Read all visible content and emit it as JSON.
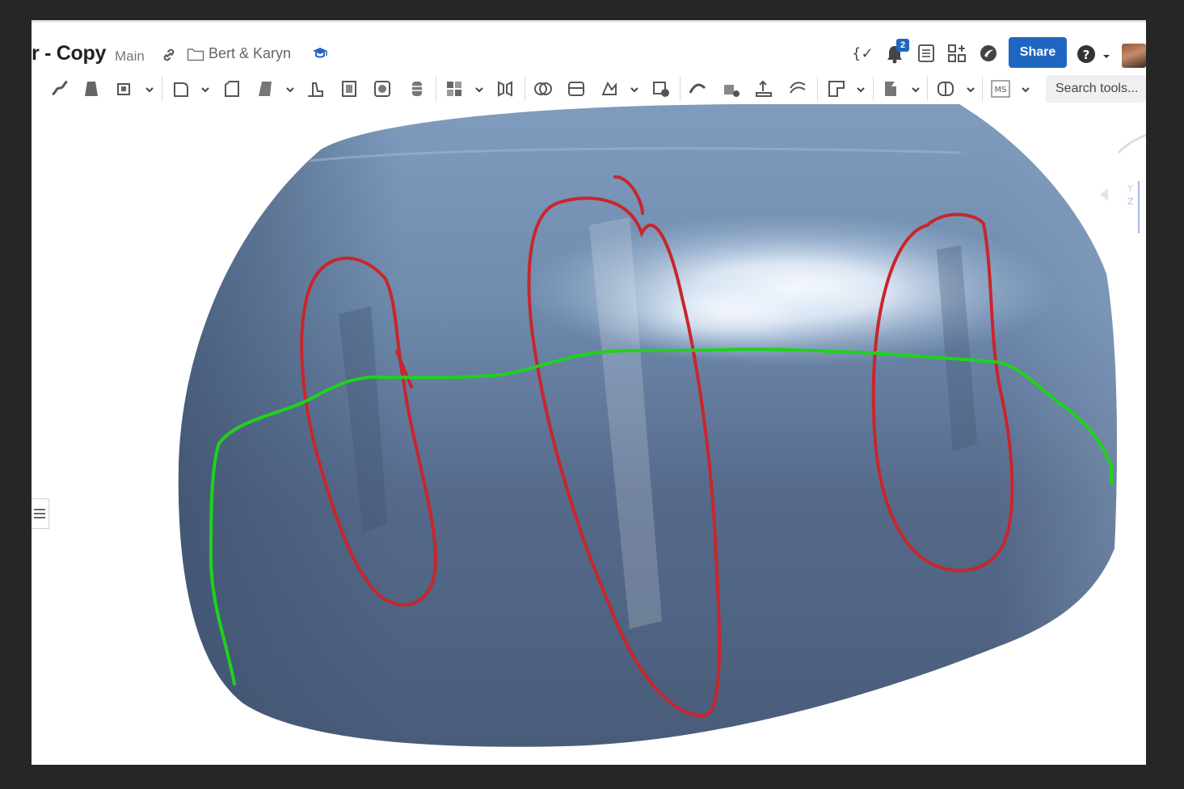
{
  "header": {
    "document_title": "r - Copy",
    "workspace": "Main",
    "folder": "Bert & Karyn",
    "notification_count": "2",
    "share_label": "Share"
  },
  "toolbar": {
    "search_placeholder": "Search tools...",
    "ms_label": "MS"
  },
  "icons": [
    "link-icon",
    "folder-icon",
    "learning-center-icon",
    "variables-icon",
    "notifications-icon",
    "tasks-icon",
    "app-store-icon",
    "render-icon",
    "help-icon",
    "avatar"
  ],
  "annotations": {
    "red_ovals": 3,
    "green_line": 1,
    "colors": {
      "red": "#c8262b",
      "green": "#1fd21c"
    }
  },
  "colors": {
    "brand": "#1f66c0",
    "surface_dark": "#4a5f7c",
    "surface_light": "#a9c1dc",
    "background": "#262626"
  }
}
